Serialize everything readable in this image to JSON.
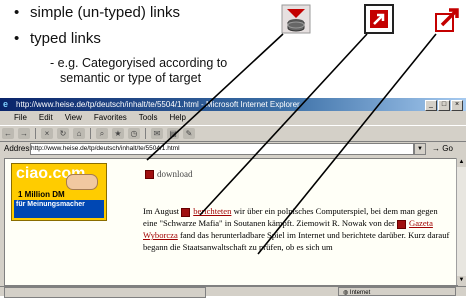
{
  "slide": {
    "bullets": [
      {
        "bullet": "•",
        "text": "simple (un-typed) links"
      },
      {
        "bullet": "•",
        "text": "typed links"
      }
    ],
    "sub_bullet": {
      "marker": "-",
      "line1": "e.g. Categoryised according to",
      "line2": "semantic or type of target"
    },
    "link_type_icons": [
      "database-download-icon",
      "arrow-box-icon",
      "external-arrow-icon"
    ],
    "colors": {
      "icon_red": "#c40000",
      "arrow": "#000000"
    }
  },
  "browser": {
    "title": "http://www.heise.de/tp/deutsch/inhalt/te/5504/1.html - Microsoft Internet Explorer",
    "menu": [
      "File",
      "Edit",
      "View",
      "Favorites",
      "Tools",
      "Help"
    ],
    "address_label": "Address",
    "address_value": "http://www.heise.de/tp/deutsch/inhalt/te/5504/1.html",
    "go_label": "Go",
    "status_zone": "Internet",
    "colors": {
      "titlebar": "#0a246a",
      "link": "#a00000"
    }
  },
  "page": {
    "banner": {
      "logo": "ciao.com",
      "prize_line1": "1 Million DM",
      "prize_line2": "für Meinungsmacher"
    },
    "download_label": "download",
    "article": {
      "p1_a": "Im August",
      "link1": "berichteten",
      "p1_b": "wir über ein polnisches Computerspiel, bei dem man gegen eine \"Schwarze Mafia\" in Soutanen kämpft. Ziemowit R. Nowak von der",
      "link2": "Gazeta Wyborcza",
      "p1_c": "fand das herunterladbare Spiel im Internet und berichtete darüber. Kurz darauf begann die Staatsanwaltschaft zu prüfen, ob es sich um"
    }
  }
}
